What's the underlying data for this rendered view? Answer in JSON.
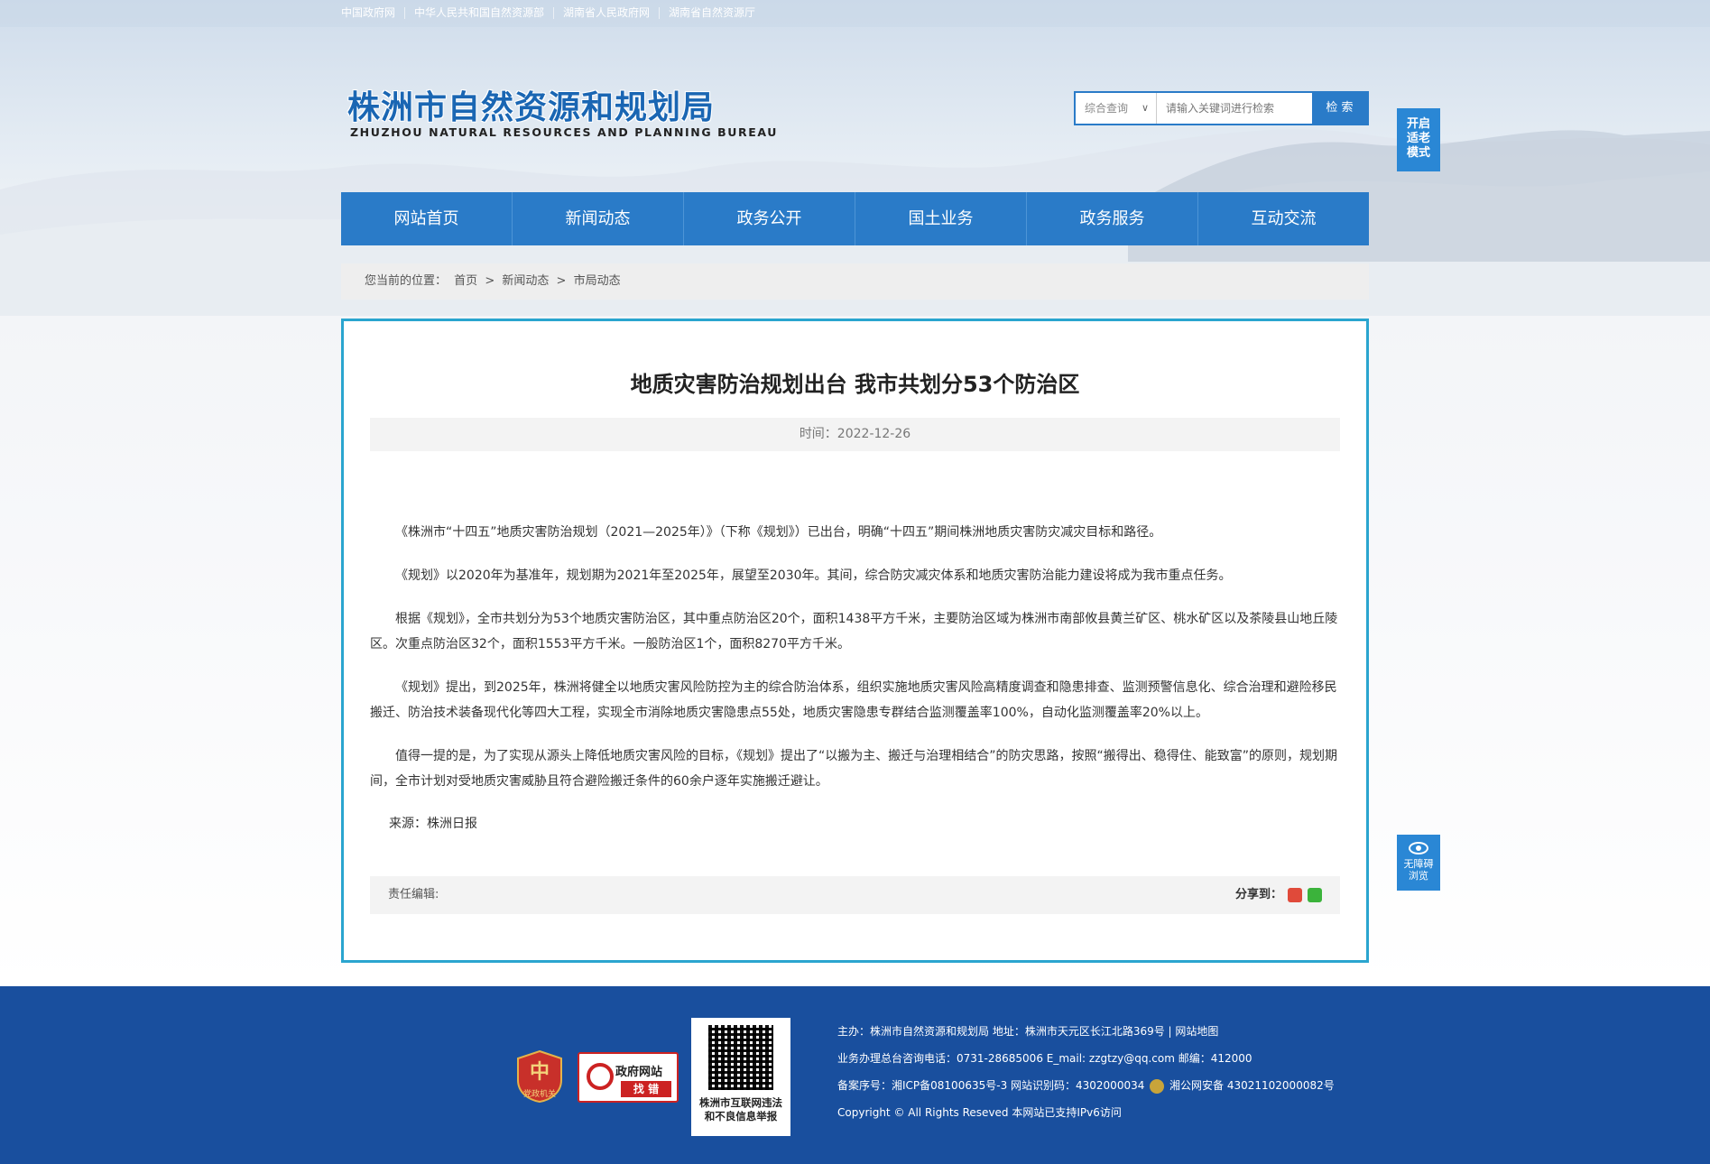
{
  "top_links": [
    "中国政府网",
    "中华人民共和国自然资源部",
    "湖南省人民政府网",
    "湖南省自然资源厅"
  ],
  "logo": {
    "cn": "株洲市自然资源和规划局",
    "en": "ZHUZHOU NATURAL RESOURCES AND PLANNING BUREAU"
  },
  "search": {
    "select_label": "综合查询",
    "placeholder": "请输入关键词进行检索",
    "button": "检 索"
  },
  "elder_mode": "开启适老模式",
  "nav": [
    "网站首页",
    "新闻动态",
    "政务公开",
    "国土业务",
    "政务服务",
    "互动交流"
  ],
  "breadcrumb": {
    "prefix": "您当前的位置：",
    "items": [
      "首页",
      "新闻动态",
      "市局动态"
    ],
    "sep": ">"
  },
  "article": {
    "title": "地质灾害防治规划出台 我市共划分53个防治区",
    "time": "时间：2022-12-26",
    "paragraphs": [
      "《株洲市“十四五”地质灾害防治规划（2021—2025年）》（下称《规划》）已出台，明确“十四五”期间株洲地质灾害防灾减灾目标和路径。",
      "《规划》以2020年为基准年，规划期为2021年至2025年，展望至2030年。其间，综合防灾减灾体系和地质灾害防治能力建设将成为我市重点任务。",
      "根据《规划》，全市共划分为53个地质灾害防治区，其中重点防治区20个，面积1438平方千米，主要防治区域为株洲市南部攸县黄兰矿区、桃水矿区以及茶陵县山地丘陵区。次重点防治区32个，面积1553平方千米。一般防治区1个，面积8270平方千米。",
      "《规划》提出，到2025年，株洲将健全以地质灾害风险防控为主的综合防治体系，组织实施地质灾害风险高精度调查和隐患排查、监测预警信息化、综合治理和避险移民搬迁、防治技术装备现代化等四大工程，实现全市消除地质灾害隐患点55处，地质灾害隐患专群结合监测覆盖率100%，自动化监测覆盖率20%以上。",
      "值得一提的是，为了实现从源头上降低地质灾害风险的目标，《规划》提出了“以搬为主、搬迁与治理相结合”的防灾思路，按照“搬得出、稳得住、能致富”的原则，规划期间，全市计划对受地质灾害威胁且符合避险搬迁条件的60余户逐年实施搬迁避让。"
    ],
    "source": "来源：株洲日报",
    "editor": "责任编辑:",
    "share_label": "分享到："
  },
  "accessibility": {
    "line1": "无障碍",
    "line2": "浏览"
  },
  "footer": {
    "badge1": "党政机关",
    "badge2": {
      "line1": "政府网站",
      "line2": "找 错"
    },
    "qr_caption": "株洲市互联网违法和不良信息举报",
    "lines": [
      "主办：株洲市自然资源和规划局   地址：株洲市天元区长江北路369号  |  网站地图",
      "业务办理总台咨询电话：0731-28685006    E_mail:    zzgtzy@qq.com    邮编：412000",
      "备案序号：湘ICP备08100635号-3 网站识别码：4302000034",
      "湘公网安备 43021102000082号",
      "Copyright © All Rights Reseved 本网站已支持IPv6访问"
    ]
  },
  "colors": {
    "primary": "#2a7bc8",
    "footer": "#194f9e",
    "article_border": "#2aa5cf"
  }
}
